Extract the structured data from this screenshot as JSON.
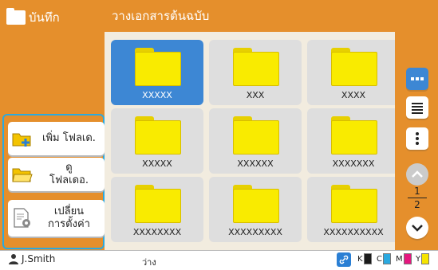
{
  "app": {
    "title": "บันทึก"
  },
  "header": {
    "title": "วางเอกสารต้นฉบับ"
  },
  "actions": [
    {
      "label": "เพิ่ม โฟลเด.",
      "icon": "folder-add-icon"
    },
    {
      "label_line1": "ดู",
      "label_line2": "โฟลเดอ.",
      "icon": "folder-open-icon"
    },
    {
      "label_line1": "เปลี่ยน",
      "label_line2": "การตั้งค่า",
      "icon": "document-settings-icon"
    }
  ],
  "folders": [
    {
      "name": "XXXXX",
      "selected": true
    },
    {
      "name": "XXX",
      "selected": false
    },
    {
      "name": "XXXX",
      "selected": false
    },
    {
      "name": "XXXXX",
      "selected": false
    },
    {
      "name": "XXXXXX",
      "selected": false
    },
    {
      "name": "XXXXXXX",
      "selected": false
    },
    {
      "name": "XXXXXXXX",
      "selected": false
    },
    {
      "name": "XXXXXXXXX",
      "selected": false
    },
    {
      "name": "XXXXXXXXXX",
      "selected": false
    }
  ],
  "sidebar": {
    "view_grid_icon": "grid-view-icon",
    "view_list_icon": "list-view-icon",
    "more_icon": "more-options-icon",
    "page_current": "1",
    "page_total": "2"
  },
  "status": {
    "user": "J.Smith",
    "text": "ว่าง",
    "inks": [
      {
        "label": "K",
        "color": "#1a1a1a"
      },
      {
        "label": "C",
        "color": "#2aa9e0"
      },
      {
        "label": "M",
        "color": "#e5177f"
      },
      {
        "label": "Y",
        "color": "#f5e400"
      }
    ]
  },
  "colors": {
    "accent": "#e58f2c",
    "highlight": "#2aa9e0",
    "selected": "#3d87d4",
    "folder": "#f9eb00"
  }
}
